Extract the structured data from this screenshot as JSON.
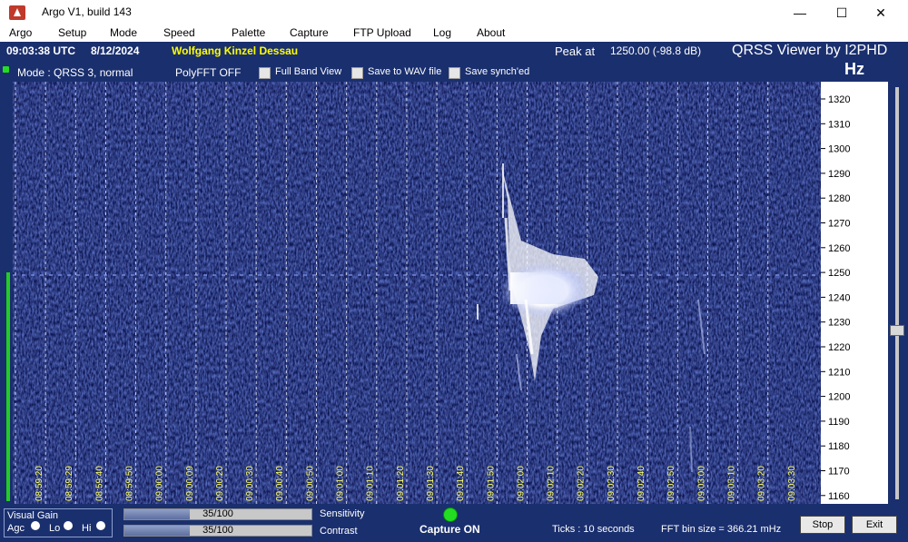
{
  "window": {
    "title": "Argo V1, build 143",
    "minimize": "—",
    "maximize": "☐",
    "close": "✕"
  },
  "menu": [
    "Argo",
    "Setup",
    "Mode",
    "Speed",
    "Palette",
    "Capture",
    "FTP Upload",
    "Log",
    "About"
  ],
  "info": {
    "time": "09:03:38 UTC",
    "date": "8/12/2024",
    "station": "Wolfgang Kinzel Dessau",
    "peak_label": "Peak at",
    "peak_value": "1250.00 (-98.8 dB)",
    "app_credit": "QRSS Viewer by I2PHD",
    "mode": "Mode : QRSS 3, normal",
    "polyfft": "PolyFFT OFF",
    "unit": "Hz"
  },
  "options": [
    {
      "label": "Full Band View",
      "checked": false
    },
    {
      "label": "Save to WAV file",
      "checked": false
    },
    {
      "label": "Save synch'ed",
      "checked": false
    }
  ],
  "freq_ticks": [
    "1320",
    "1310",
    "1300",
    "1290",
    "1280",
    "1270",
    "1260",
    "1250",
    "1240",
    "1230",
    "1220",
    "1210",
    "1200",
    "1190",
    "1180",
    "1170",
    "1160"
  ],
  "time_ticks": [
    "08:59:20",
    "08:59:29",
    "08:59:40",
    "08:59:50",
    "09:00:00",
    "09:00:09",
    "09:00:20",
    "09:00:30",
    "09:00:40",
    "09:00:50",
    "09:01:00",
    "09:01:10",
    "09:01:20",
    "09:01:30",
    "09:01:40",
    "09:01:50",
    "09:02:00",
    "09:02:10",
    "09:02:20",
    "09:02:30",
    "09:02:40",
    "09:02:50",
    "09:03:00",
    "09:03:10",
    "09:03:20",
    "09:03:30"
  ],
  "bottom": {
    "visual_gain": "Visual Gain",
    "agc": "Agc",
    "lo": "Lo",
    "hi": "Hi",
    "sensitivity_value": "35/100",
    "sensitivity_fraction": 0.35,
    "sensitivity_label": "Sensitivity",
    "contrast_value": "35/100",
    "contrast_fraction": 0.35,
    "contrast_label": "Contrast",
    "capture_status": "Capture ON",
    "ticks": "Ticks  : 10 seconds",
    "fft_bin": "FFT bin size = 366.21 mHz",
    "stop": "Stop",
    "exit": "Exit"
  },
  "colors": {
    "panel": "#1a2f6e",
    "station": "#ffff00",
    "waterfall_bg": "#0d1550",
    "capture_led": "#22dd22"
  }
}
